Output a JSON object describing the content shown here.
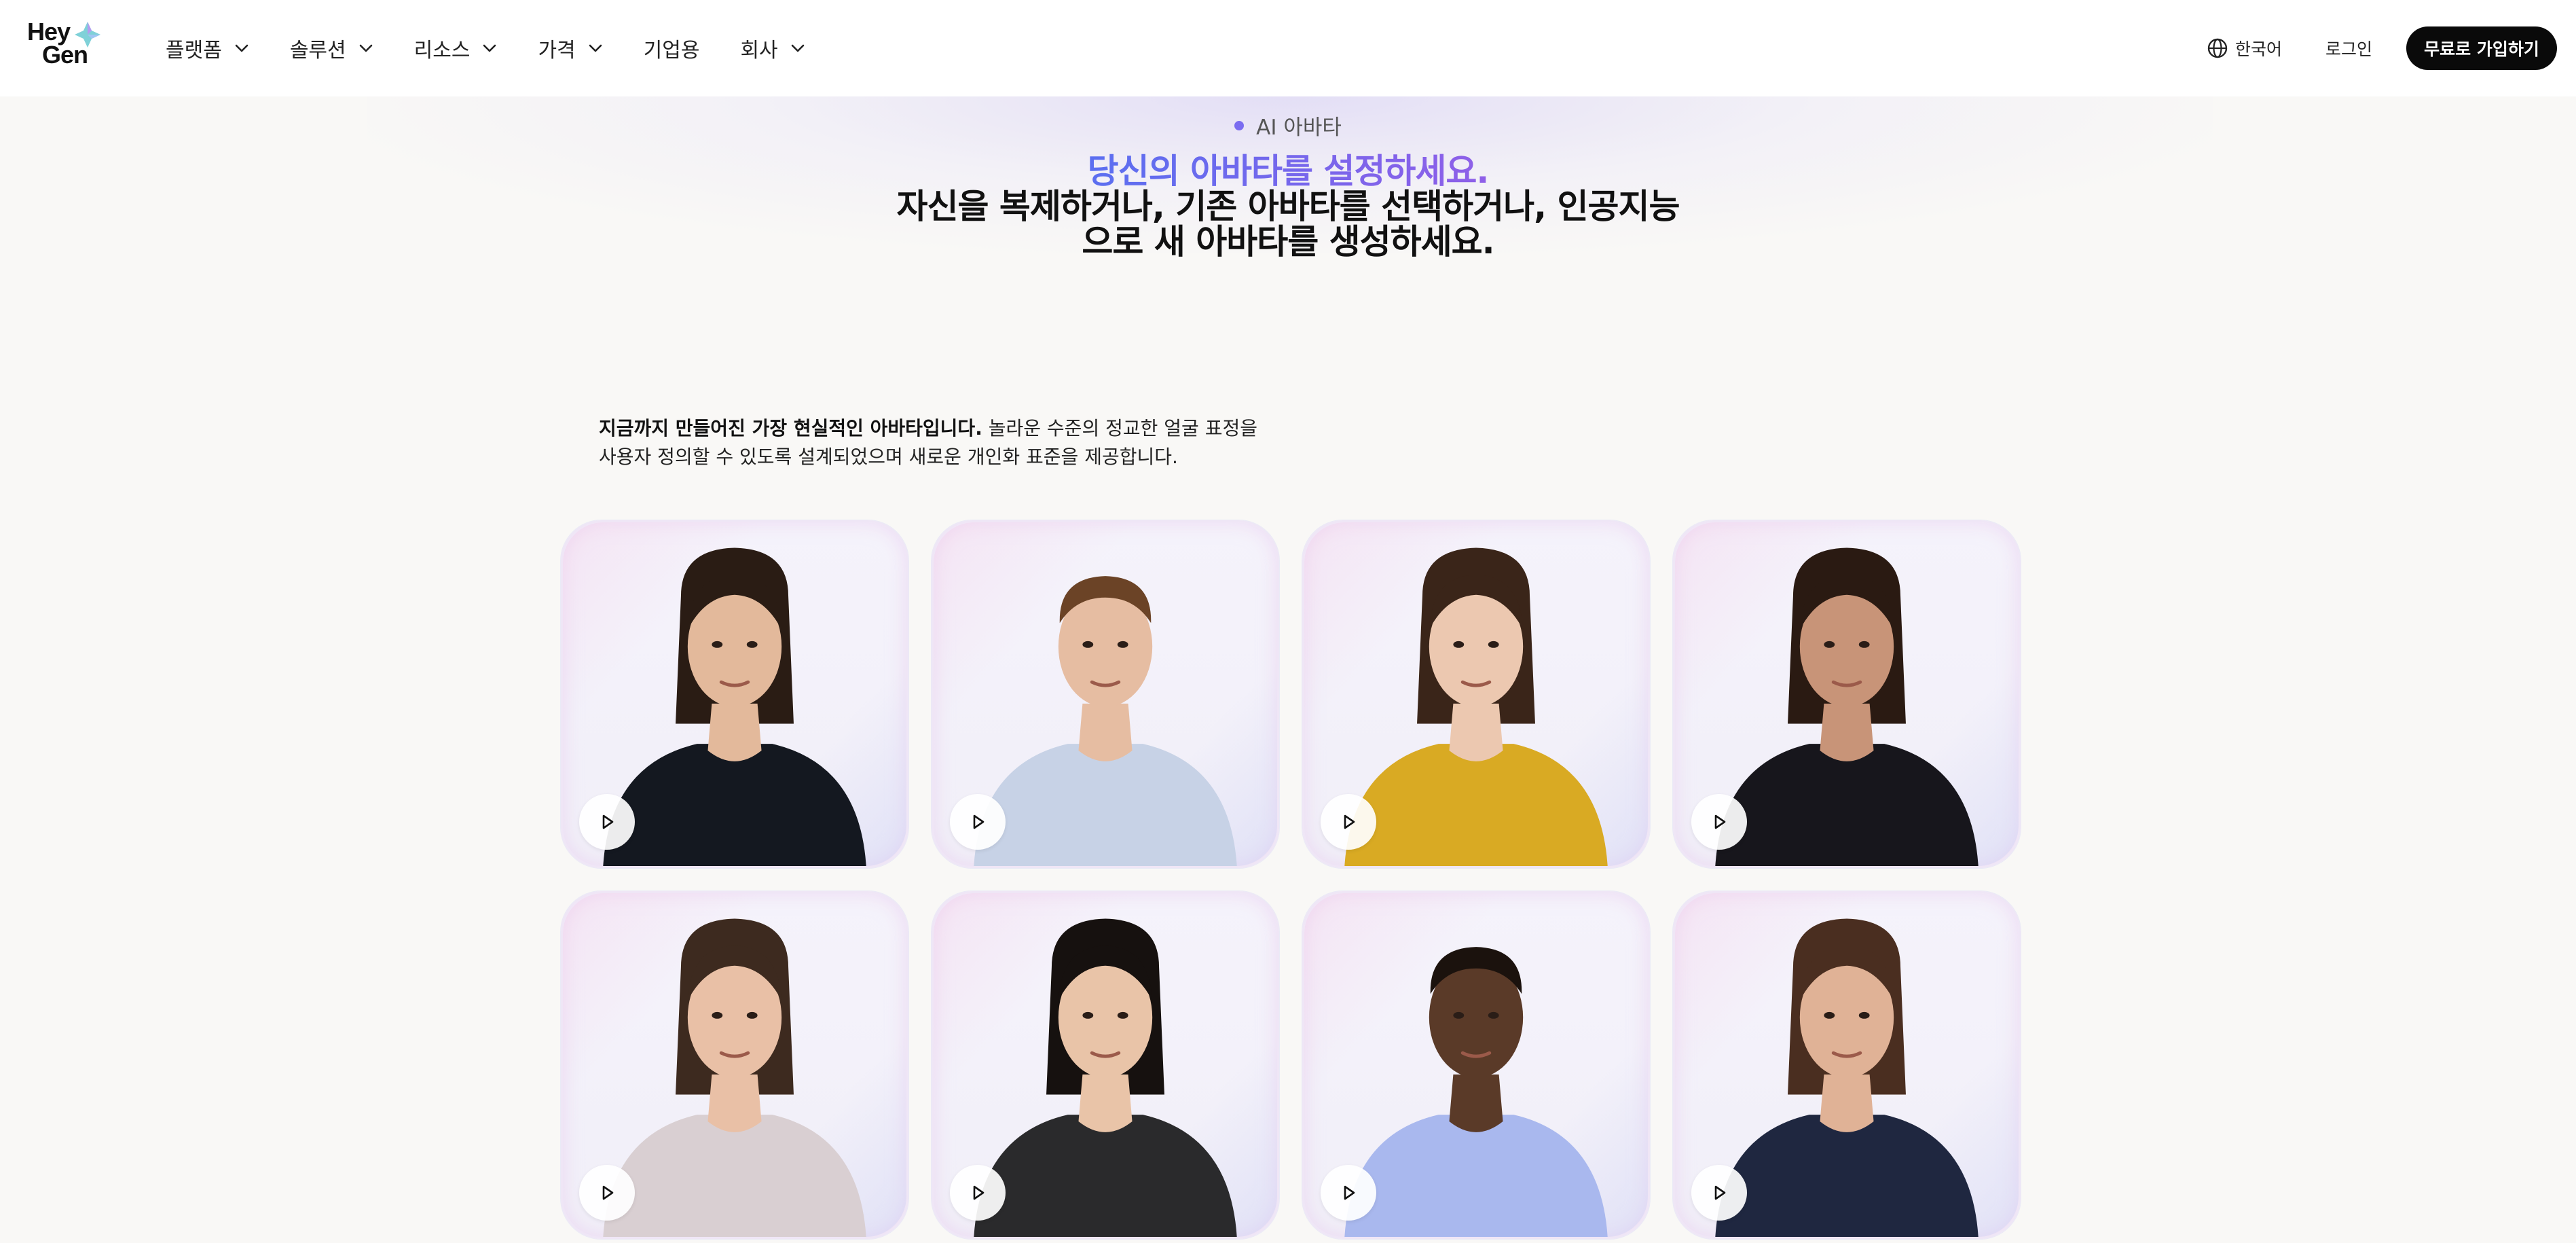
{
  "nav": {
    "logo_line1": "Hey",
    "logo_line2": "Gen",
    "menu": [
      {
        "label": "플랫폼",
        "has_dropdown": true
      },
      {
        "label": "솔루션",
        "has_dropdown": true
      },
      {
        "label": "리소스",
        "has_dropdown": true
      },
      {
        "label": "가격",
        "has_dropdown": true
      },
      {
        "label": "기업용",
        "has_dropdown": false
      },
      {
        "label": "회사",
        "has_dropdown": true
      }
    ],
    "language": "한국어",
    "login": "로그인",
    "signup": "무료로 가입하기"
  },
  "hero": {
    "eyebrow": "AI 아바타",
    "headline_accent": "당신의 아바타를 설정하세요.",
    "headline_line2": "자신을 복제하거나, 기존 아바타를 선택하거나, 인공지능",
    "headline_line3": "으로 새 아바타를 생성하세요."
  },
  "description": {
    "bold": "지금까지 만들어진 가장 현실적인 아바타입니다.",
    "rest_line1": " 놀라운 수준의 정교한 얼굴 표정을",
    "line2": "사용자 정의할 수 있도록 설계되었으며 새로운 개인화 표준을 제공합니다."
  },
  "avatars": [
    {
      "id": "avatar-1",
      "skin": "#e3b99b",
      "hair": "#2a1c14",
      "top": "#141820",
      "icon": "play-icon"
    },
    {
      "id": "avatar-2",
      "skin": "#e6bda2",
      "hair": "#6b4326",
      "top": "#c7d2e6",
      "icon": "play-icon"
    },
    {
      "id": "avatar-3",
      "skin": "#ecc8b0",
      "hair": "#3a2519",
      "top": "#d9aa23",
      "icon": "play-icon"
    },
    {
      "id": "avatar-4",
      "skin": "#c89478",
      "hair": "#2a1a12",
      "top": "#17161c",
      "icon": "play-icon"
    },
    {
      "id": "avatar-5",
      "skin": "#e9c0a6",
      "hair": "#3d2a1f",
      "top": "#d9cfd2",
      "icon": "play-icon"
    },
    {
      "id": "avatar-6",
      "skin": "#e9c4a8",
      "hair": "#16110f",
      "top": "#2a2a2c",
      "icon": "play-icon"
    },
    {
      "id": "avatar-7",
      "skin": "#5a3a28",
      "hair": "#1b120d",
      "top": "#a9b8ee",
      "icon": "play-icon"
    },
    {
      "id": "avatar-8",
      "skin": "#e0b296",
      "hair": "#4a2e20",
      "top": "#1f2740",
      "icon": "play-icon"
    }
  ],
  "colors": {
    "accent_gradient_start": "#5b6ff0",
    "accent_gradient_end": "#8f5fe8",
    "signup_bg": "#0a0a0a",
    "page_bg": "#f9f8f6"
  }
}
